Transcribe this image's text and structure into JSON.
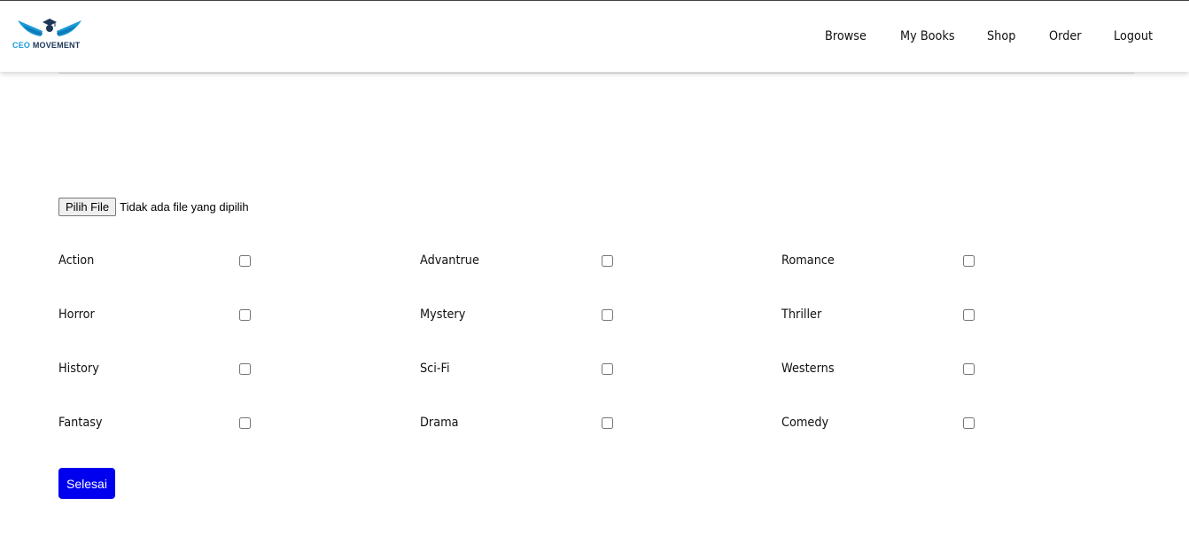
{
  "header": {
    "logo": {
      "brand_primary": "CEO",
      "brand_secondary": "MOVEMENT",
      "icon": "graduation-cap-wings-icon",
      "colors": {
        "primary": "#1a9ad9",
        "secondary": "#1d3557"
      }
    },
    "nav": [
      {
        "label": "Browse"
      },
      {
        "label": "My Books"
      },
      {
        "label": "Shop"
      },
      {
        "label": "Order"
      },
      {
        "label": "Logout"
      }
    ]
  },
  "upload": {
    "button_label": "Pilih File",
    "status": "Tidak ada file yang dipilih"
  },
  "genres": [
    {
      "label": "Action",
      "checked": false
    },
    {
      "label": "Advantrue",
      "checked": false
    },
    {
      "label": "Romance",
      "checked": false
    },
    {
      "label": "Horror",
      "checked": false
    },
    {
      "label": "Mystery",
      "checked": false
    },
    {
      "label": "Thriller",
      "checked": false
    },
    {
      "label": "History",
      "checked": false
    },
    {
      "label": "Sci-Fi",
      "checked": false
    },
    {
      "label": "Westerns",
      "checked": false
    },
    {
      "label": "Fantasy",
      "checked": false
    },
    {
      "label": "Drama",
      "checked": false
    },
    {
      "label": "Comedy",
      "checked": false
    }
  ],
  "submit": {
    "label": "Selesai",
    "color": "#0000ee"
  }
}
